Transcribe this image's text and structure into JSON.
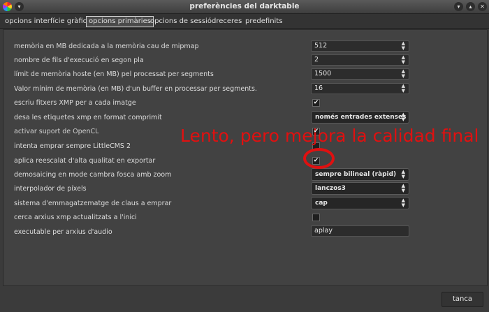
{
  "window": {
    "title": "preferències del darktable"
  },
  "tabs": [
    {
      "label": "opcions interfície gràfica"
    },
    {
      "label": "opcions primàries"
    },
    {
      "label": "opcions de sessió"
    },
    {
      "label": "dreceres"
    },
    {
      "label": "predefinits"
    }
  ],
  "settings": {
    "mipmap": {
      "label": "memòria en MB dedicada a la memòria cau de mipmap",
      "value": "512"
    },
    "threads": {
      "label": "nombre de fils d'execució en segon pla",
      "value": "2"
    },
    "host_mem": {
      "label": "límit de memòria hoste (en MB) pel processat per segments",
      "value": "1500"
    },
    "min_buffer": {
      "label": "Valor mínim de memòria (en MB) d'un buffer en processar per segments.",
      "value": "16"
    },
    "write_xmp": {
      "label": "escriu fitxers XMP per a cada imatge",
      "checked": true
    },
    "compress_xmp": {
      "label": "desa les etiquetes xmp en format comprimit",
      "value": "només entrades extenses"
    },
    "opencl": {
      "label": "activar suport de OpenCL",
      "checked": true
    },
    "lcms": {
      "label": "intenta emprar sempre LittleCMS 2",
      "checked": false
    },
    "upscale": {
      "label": "aplica reescalat d'alta qualitat en exportar",
      "checked": true
    },
    "demosaic": {
      "label": "demosaicing en mode cambra fosca amb zoom",
      "value": "sempre bilineal (ràpid)"
    },
    "interp": {
      "label": "interpolador de píxels",
      "value": "lanczos3"
    },
    "keyring": {
      "label": "sistema d'emmagatzematge de claus a emprar",
      "value": "cap"
    },
    "scan_xmp": {
      "label": "cerca arxius xmp actualitzats a l'inici",
      "checked": false
    },
    "audio": {
      "label": "executable per arxius d'audio",
      "value": "aplay"
    }
  },
  "annotation": {
    "text": "Lento, pero mejora la calidad final",
    "color": "#e01010"
  },
  "footer": {
    "close_label": "tanca"
  },
  "icons": {
    "check": "✔",
    "spin_up": "▲",
    "spin_down": "▼",
    "combo": "⌃⌄"
  }
}
